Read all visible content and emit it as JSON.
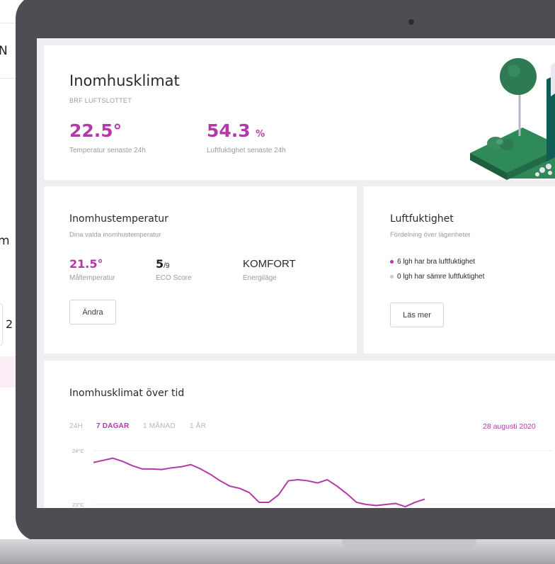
{
  "background_page": {
    "edge_text_top": "N",
    "edge_text_mid": "m",
    "edge_text_low": "2"
  },
  "climate": {
    "title": "Inomhusklimat",
    "subtitle": "BRF LUFTSLOTTET",
    "temperature_value": "22.5°",
    "temperature_label": "Temperatur senaste 24h",
    "humidity_value": "54.3",
    "humidity_unit": "%",
    "humidity_label": "Luftfuktighet senaste 24h"
  },
  "temperature": {
    "title": "Inomhustemperatur",
    "subtitle": "Dina valda inomhustemperatur",
    "target_value": "21.5°",
    "target_label": "Måltemperatur",
    "eco_value": "5",
    "eco_of": "/9",
    "eco_label": "ECO Score",
    "mode_value": "KOMFORT",
    "mode_label": "Energiläge",
    "change_button": "Ändra"
  },
  "humidity": {
    "title": "Luftfuktighet",
    "subtitle": "Fördelning över lägenheter",
    "good_text": "6 lgh har bra luftfuktighet",
    "bad_text": "0 lgh har sämre luftfuktighet",
    "read_more_button": "Läs mer",
    "good_color": "#b23aa8",
    "bad_color": "#c8c8cd"
  },
  "history": {
    "title": "Inomhusklimat över tid",
    "tabs": [
      "24H",
      "7 DAGAR",
      "1 MÅNAD",
      "1 ÅR"
    ],
    "active_tab": "7 DAGAR",
    "date": "28 augusti 2020",
    "y_top_label": "24°C",
    "y_bottom_label": "23°C"
  },
  "chart_data": {
    "type": "line",
    "title": "Inomhusklimat över tid",
    "xlabel": "",
    "ylabel": "",
    "y_ticks": [
      "24°C",
      "23°C"
    ],
    "ylim": [
      23,
      24
    ],
    "x": [
      0,
      1,
      2,
      3,
      4,
      5,
      6,
      7,
      8,
      9,
      10,
      11,
      12,
      13,
      14,
      15,
      16,
      17,
      18,
      19,
      20,
      21,
      22,
      23,
      24,
      25,
      26,
      27,
      28,
      29,
      30,
      31,
      32,
      33,
      34
    ],
    "series": [
      {
        "values": [
          23.78,
          23.82,
          23.86,
          23.8,
          23.72,
          23.66,
          23.66,
          23.65,
          23.68,
          23.7,
          23.74,
          23.66,
          23.56,
          23.44,
          23.34,
          23.3,
          23.22,
          23.04,
          23.04,
          23.18,
          23.44,
          23.46,
          23.44,
          23.4,
          23.46,
          23.34,
          23.2,
          23.04,
          23.0,
          22.98,
          23.0,
          23.02,
          22.96,
          23.04,
          23.1
        ],
        "color": "#b23aa8"
      }
    ],
    "grid": true
  }
}
